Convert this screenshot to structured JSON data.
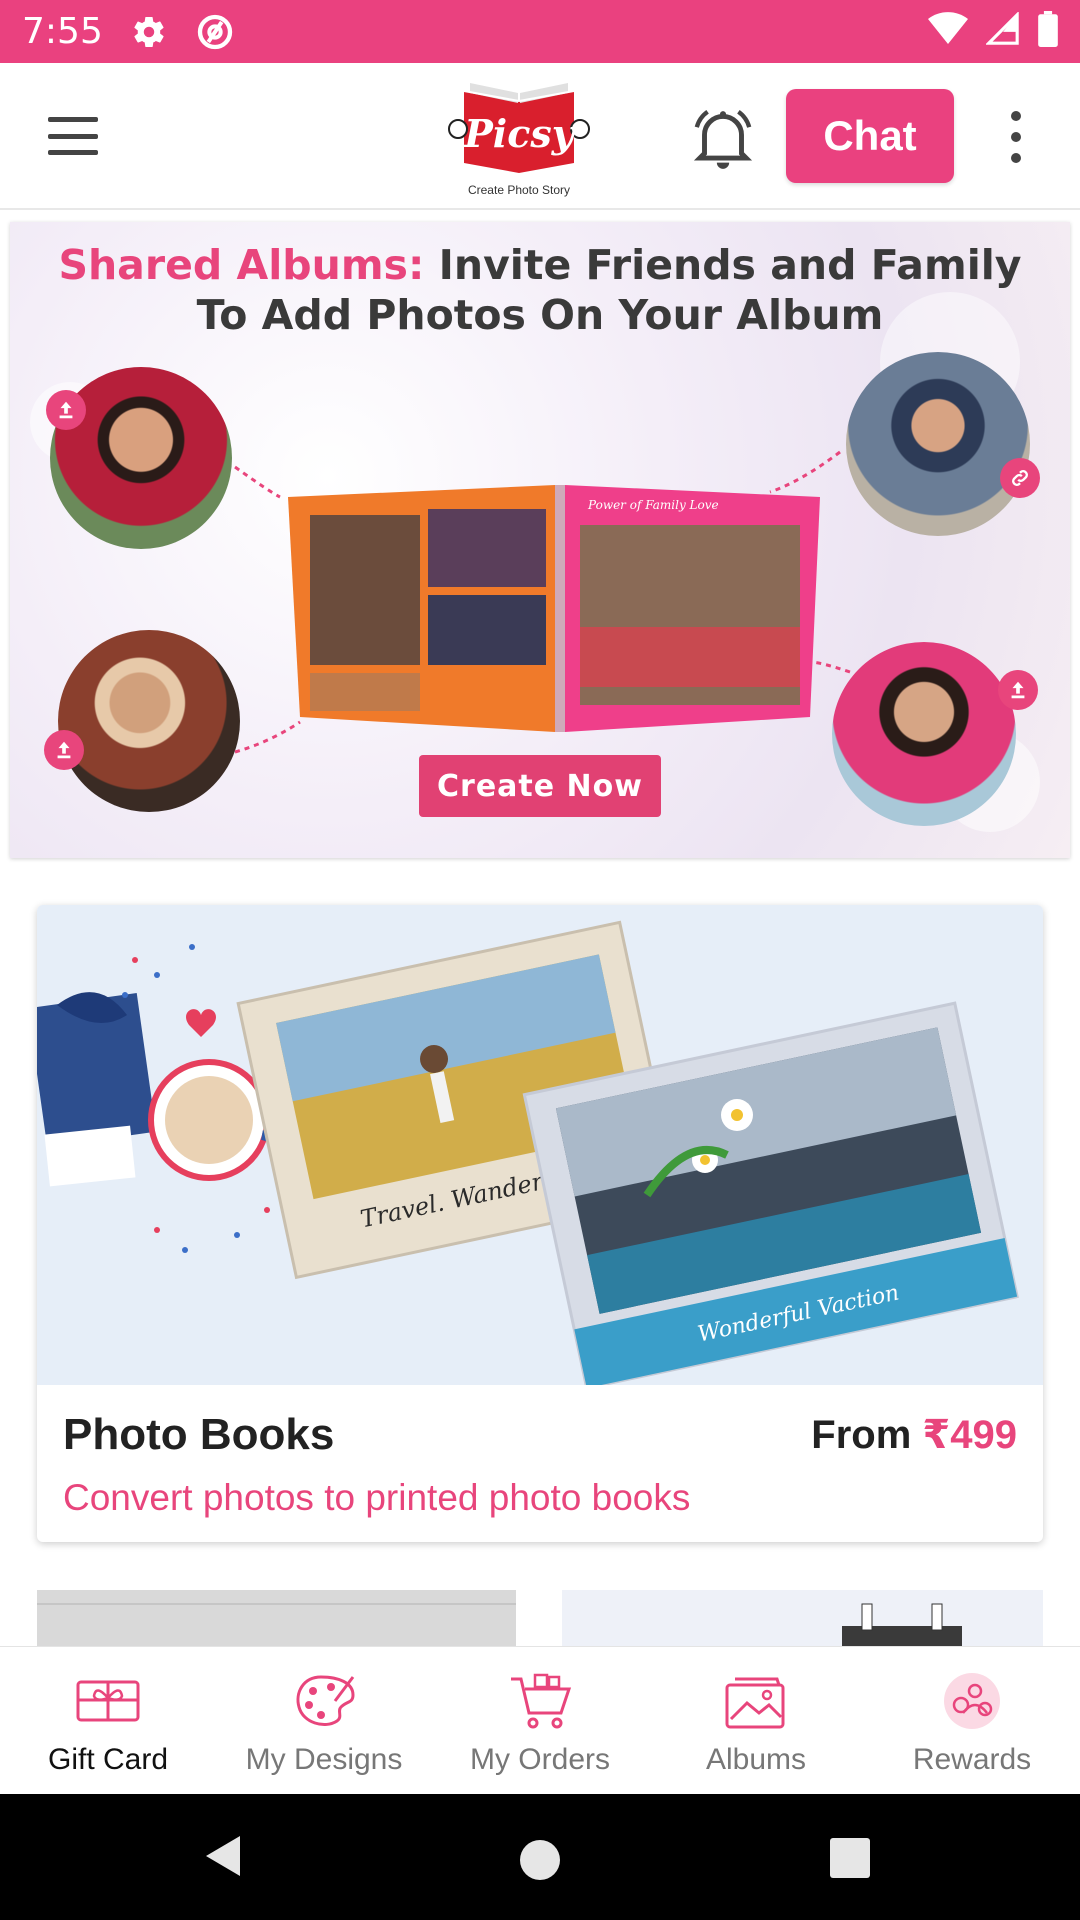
{
  "status_bar": {
    "time": "7:55"
  },
  "app_bar": {
    "logo_text": "Picsy",
    "logo_tagline": "Create Photo Story",
    "chat_label": "Chat"
  },
  "hero": {
    "title_accent": "Shared Albums:",
    "title_rest_line1": " Invite Friends and Family",
    "title_line2": "To Add Photos On Your Album",
    "book_page_caption": "Power of Family Love",
    "cta_label": "Create Now"
  },
  "product_card": {
    "title": "Photo Books",
    "price_prefix": "From",
    "price_amount": "₹499",
    "subtitle": "Convert photos to printed photo books",
    "book1_caption": "Travel. Wander. Repeat.",
    "book2_caption": "Wonderful Vaction"
  },
  "bottom_nav": {
    "items": [
      {
        "label": "Gift Card",
        "icon": "gift-card-icon",
        "active": true
      },
      {
        "label": "My Designs",
        "icon": "palette-icon",
        "active": false
      },
      {
        "label": "My Orders",
        "icon": "cart-icon",
        "active": false
      },
      {
        "label": "Albums",
        "icon": "album-icon",
        "active": false
      },
      {
        "label": "Rewards",
        "icon": "rewards-icon",
        "active": false
      }
    ]
  },
  "colors": {
    "brand_pink": "#ea417f",
    "accent_pink": "#e8457c",
    "text_dark": "#222222",
    "nav_inactive": "#777777"
  }
}
